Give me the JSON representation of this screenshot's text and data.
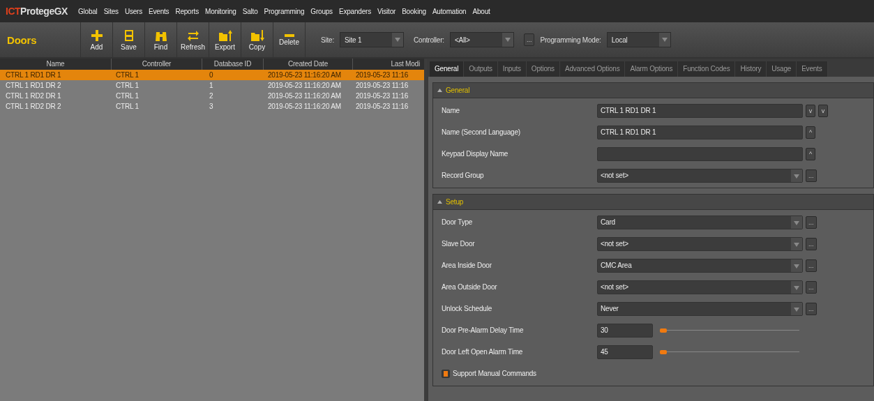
{
  "app": {
    "logo_prefix": "ICT",
    "logo_name": "ProtegeGX"
  },
  "menu": [
    "Global",
    "Sites",
    "Users",
    "Events",
    "Reports",
    "Monitoring",
    "Salto",
    "Programming",
    "Groups",
    "Expanders",
    "Visitor",
    "Booking",
    "Automation",
    "About"
  ],
  "toolbar": {
    "title": "Doors",
    "buttons": [
      {
        "label": "Add",
        "kind": "add"
      },
      {
        "label": "Save",
        "kind": "save"
      },
      {
        "label": "Find",
        "kind": "find"
      },
      {
        "label": "Refresh",
        "kind": "refresh"
      },
      {
        "label": "Export",
        "kind": "export"
      },
      {
        "label": "Copy",
        "kind": "copy"
      },
      {
        "label": "Delete",
        "kind": "delete"
      }
    ],
    "filters": [
      {
        "label": "Site:",
        "value": "Site 1"
      },
      {
        "label": "Controller:",
        "value": "<All>",
        "extra": "..."
      },
      {
        "label": "Programming Mode:",
        "value": "Local"
      }
    ]
  },
  "table": {
    "columns": [
      "Name",
      "Controller",
      "Database ID",
      "Created Date",
      "Last Modi"
    ],
    "rows": [
      {
        "cells": [
          "CTRL 1 RD1 DR 1",
          "CTRL 1",
          "0",
          "2019-05-23 11:16:20 AM",
          "2019-05-23 11:16"
        ],
        "selected": true
      },
      {
        "cells": [
          "CTRL 1 RD1 DR 2",
          "CTRL 1",
          "1",
          "2019-05-23 11:16:20 AM",
          "2019-05-23 11:16"
        ],
        "selected": false
      },
      {
        "cells": [
          "CTRL 1 RD2 DR 1",
          "CTRL 1",
          "2",
          "2019-05-23 11:16:20 AM",
          "2019-05-23 11:16"
        ],
        "selected": false
      },
      {
        "cells": [
          "CTRL 1 RD2 DR 2",
          "CTRL 1",
          "3",
          "2019-05-23 11:16:20 AM",
          "2019-05-23 11:16"
        ],
        "selected": false
      }
    ]
  },
  "tabs": [
    {
      "label": "General",
      "selected": true
    },
    {
      "label": "Outputs",
      "selected": false
    },
    {
      "label": "Inputs",
      "selected": false
    },
    {
      "label": "Options",
      "selected": false
    },
    {
      "label": "Advanced Options",
      "selected": false
    },
    {
      "label": "Alarm Options",
      "selected": false
    },
    {
      "label": "Function Codes",
      "selected": false
    },
    {
      "label": "History",
      "selected": false
    },
    {
      "label": "Usage",
      "selected": false
    },
    {
      "label": "Events",
      "selected": false
    }
  ],
  "sections": [
    {
      "title": "General",
      "expanded": true,
      "fields": [
        {
          "kind": "text",
          "label": "Name",
          "value": "CTRL 1 RD1 DR 1",
          "buttons": [
            "v",
            "v"
          ]
        },
        {
          "kind": "text",
          "label": "Name (Second Language)",
          "value": "CTRL 1 RD1 DR 1",
          "buttons": [
            "^"
          ]
        },
        {
          "kind": "text",
          "label": "Keypad Display Name",
          "buttons": [
            "^"
          ]
        },
        {
          "kind": "dropdown",
          "label": "Record Group",
          "value": "<not set>",
          "buttons": [
            "..."
          ]
        }
      ]
    },
    {
      "title": "Setup",
      "expanded": true,
      "fields": [
        {
          "kind": "dropdown",
          "label": "Door Type",
          "value": "Card",
          "buttons": [
            "..."
          ]
        },
        {
          "kind": "dropdown",
          "label": "Slave Door",
          "value": "<not set>",
          "buttons": [
            "..."
          ]
        },
        {
          "kind": "dropdown",
          "label": "Area Inside Door",
          "value": "CMC Area",
          "buttons": [
            "..."
          ]
        },
        {
          "kind": "dropdown",
          "label": "Area Outside Door",
          "value": "<not set>",
          "buttons": [
            "..."
          ]
        },
        {
          "kind": "dropdown",
          "label": "Unlock Schedule",
          "value": "Never",
          "buttons": [
            "..."
          ]
        },
        {
          "kind": "slider",
          "label": "Door Pre-Alarm Delay Time",
          "value": "30",
          "level": 0
        },
        {
          "kind": "slider",
          "label": "Door Left Open Alarm Time",
          "value": "45",
          "level": 0
        },
        {
          "kind": "checkbox",
          "label": "Support Manual Commands",
          "checked": true
        }
      ]
    }
  ]
}
